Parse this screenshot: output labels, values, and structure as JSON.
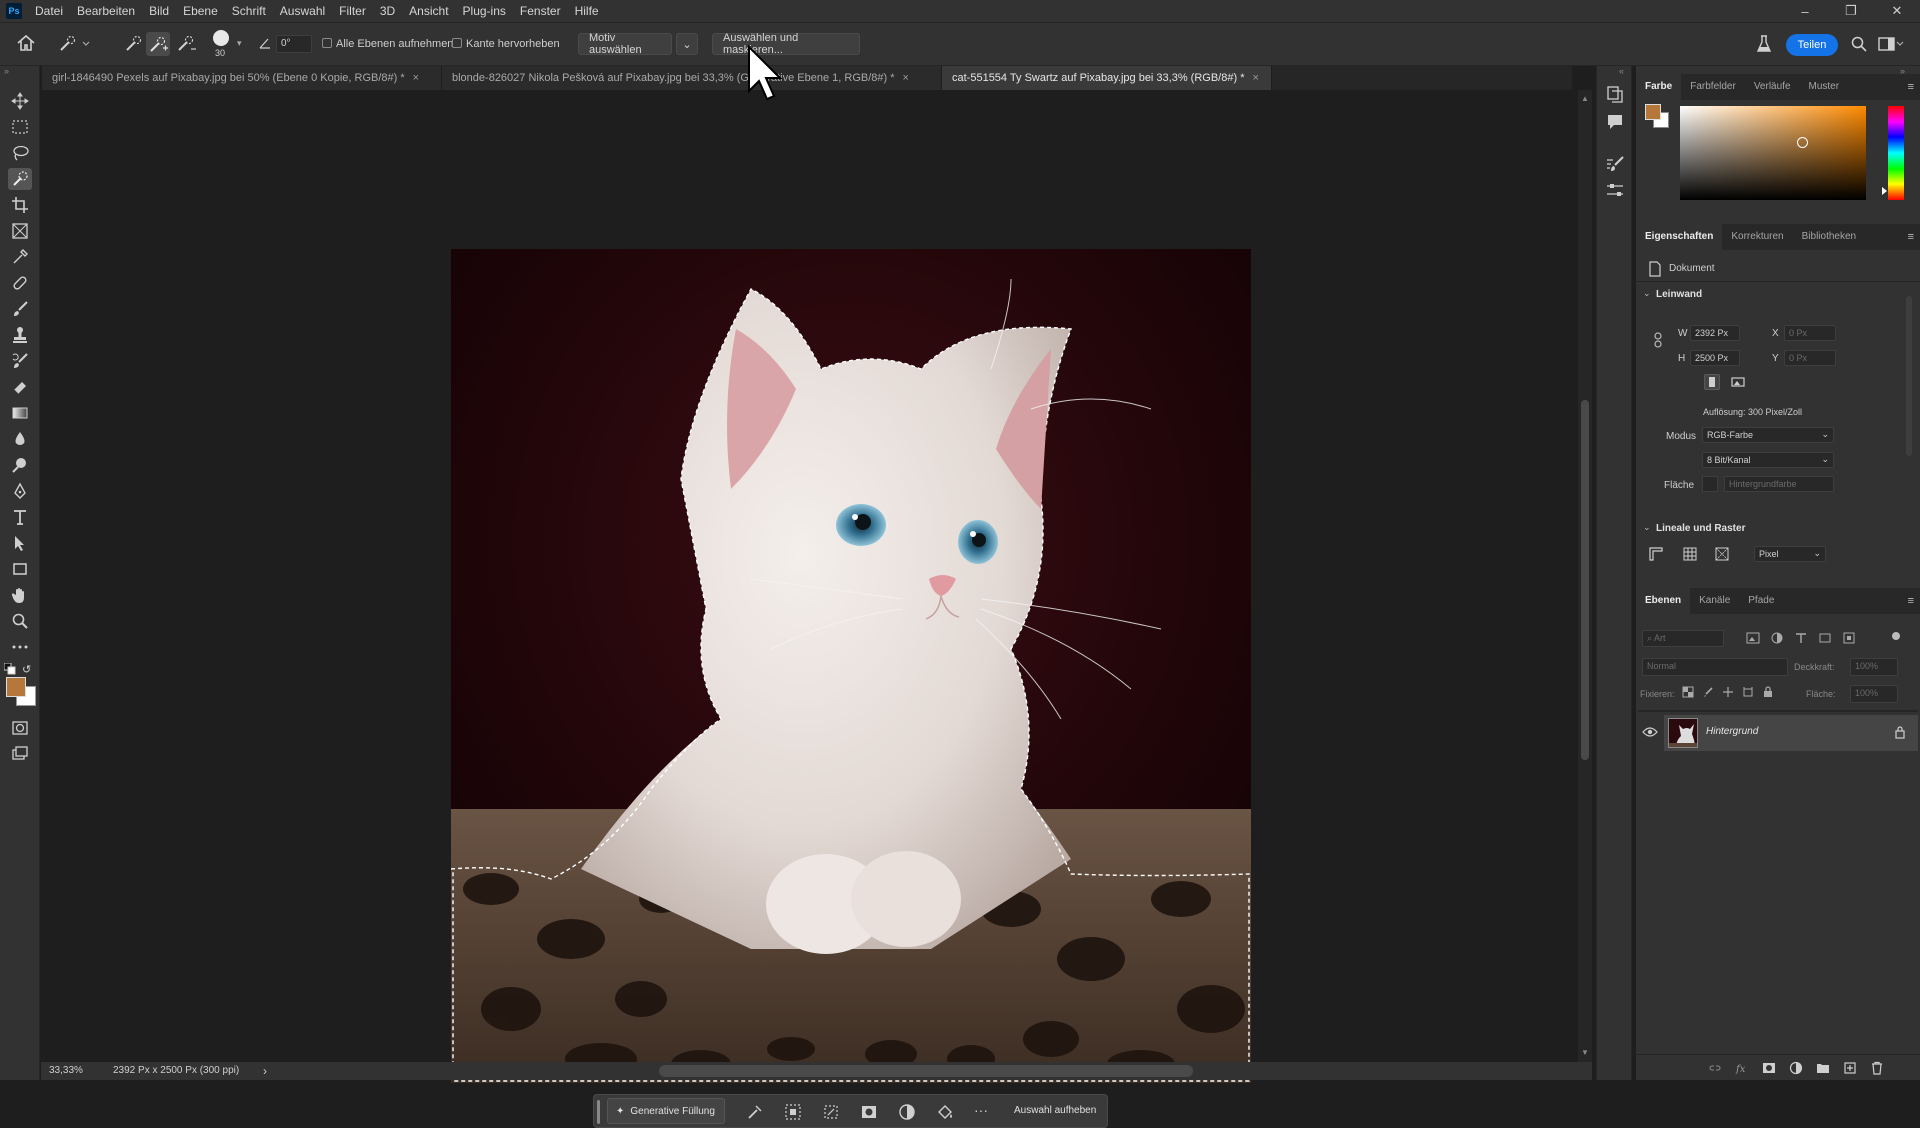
{
  "app": {
    "logo": "Ps"
  },
  "menu": [
    "Datei",
    "Bearbeiten",
    "Bild",
    "Ebene",
    "Schrift",
    "Auswahl",
    "Filter",
    "3D",
    "Ansicht",
    "Plug-ins",
    "Fenster",
    "Hilfe"
  ],
  "window_controls": {
    "minimize": "–",
    "maximize": "❐",
    "close": "✕"
  },
  "options": {
    "brush_size": "30",
    "angle": "0°",
    "sample_all_layers": "Alle Ebenen aufnehmen",
    "enhance_edge": "Kante hervorheben",
    "select_subject": "Motiv auswählen",
    "select_and_mask": "Auswählen und maskieren...",
    "share": "Teilen"
  },
  "tabs": [
    {
      "label": "girl-1846490 Pexels auf Pixabay.jpg bei 50% (Ebene 0 Kopie, RGB/8#) *",
      "close": "×"
    },
    {
      "label": "blonde-826027 Nikola Pešková auf Pixabay.jpg bei 33,3% (Generative Ebene 1, RGB/8#) *",
      "close": "×"
    },
    {
      "label": "cat-551554 Ty Swartz auf Pixabay.jpg bei 33,3% (RGB/8#) *",
      "close": "×"
    }
  ],
  "taskbar": {
    "generative_fill": "Generative Füllung",
    "more": "···",
    "deselect": "Auswahl aufheben"
  },
  "status": {
    "zoom": "33,33%",
    "doc_info": "2392 Px x 2500 Px (300 ppi)",
    "arrow": "›"
  },
  "color_panel": {
    "tabs": [
      "Farbe",
      "Farbfelder",
      "Verläufe",
      "Muster"
    ],
    "foreground": "#b5773a",
    "background": "#ffffff",
    "hue": "#ff8a00"
  },
  "properties": {
    "tabs": [
      "Eigenschaften",
      "Korrekturen",
      "Bibliotheken"
    ],
    "doc_label": "Dokument",
    "canvas_section": "Leinwand",
    "w_label": "W",
    "w_value": "2392 Px",
    "h_label": "H",
    "h_value": "2500 Px",
    "x_label": "X",
    "x_value": "0 Px",
    "y_label": "Y",
    "y_value": "0 Px",
    "resolution": "Auflösung: 300 Pixel/Zoll",
    "mode_label": "Modus",
    "mode_value": "RGB-Farbe",
    "depth_value": "8 Bit/Kanal",
    "fill_label": "Fläche",
    "fill_value": "Hintergrundfarbe",
    "rulers_section": "Lineale und Raster",
    "unit_value": "Pixel"
  },
  "layers": {
    "tabs": [
      "Ebenen",
      "Kanäle",
      "Pfade"
    ],
    "search_placeholder": "Art",
    "blend_mode": "Normal",
    "opacity_label": "Deckkraft:",
    "opacity_value": "100%",
    "lock_label": "Fixieren:",
    "fill_label": "Fläche:",
    "fill_value": "100%",
    "items": [
      {
        "name": "Hintergrund"
      }
    ]
  }
}
